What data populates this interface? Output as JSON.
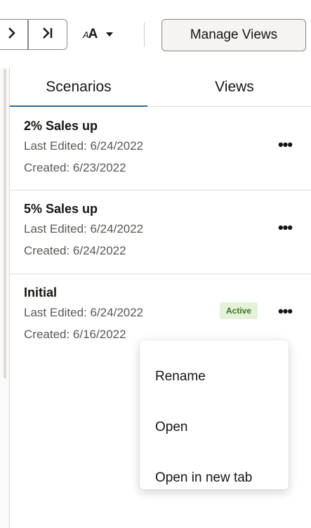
{
  "toolbar": {
    "next_icon": "chevron-right-icon",
    "last_icon": "last-page-icon",
    "font_size_icon": "font-size-icon",
    "font_size_small_glyph": "A",
    "font_size_large_glyph": "A",
    "font_dropdown_icon": "caret-down-icon",
    "manage_views_label": "Manage Views"
  },
  "tabs": [
    {
      "label": "Scenarios",
      "selected": true
    },
    {
      "label": "Views",
      "selected": false
    }
  ],
  "scenarios": [
    {
      "name": "2% Sales up",
      "last_edited": "Last Edited: 6/24/2022",
      "created": "Created: 6/23/2022",
      "badge": ""
    },
    {
      "name": "5% Sales up",
      "last_edited": "Last Edited: 6/24/2022",
      "created": "Created: 6/24/2022",
      "badge": ""
    },
    {
      "name": "Initial",
      "last_edited": "Last Edited: 6/24/2022",
      "created": "Created: 6/16/2022",
      "badge": "Active"
    }
  ],
  "more_icon": "more-options-icon",
  "more_glyph": "•••",
  "context_menu": {
    "items": [
      "Rename",
      "Open",
      "Open in new tab"
    ]
  },
  "colors": {
    "tab_underline": "#2a6b8f",
    "badge_bg": "#e4f2da",
    "badge_text": "#3c7420"
  }
}
